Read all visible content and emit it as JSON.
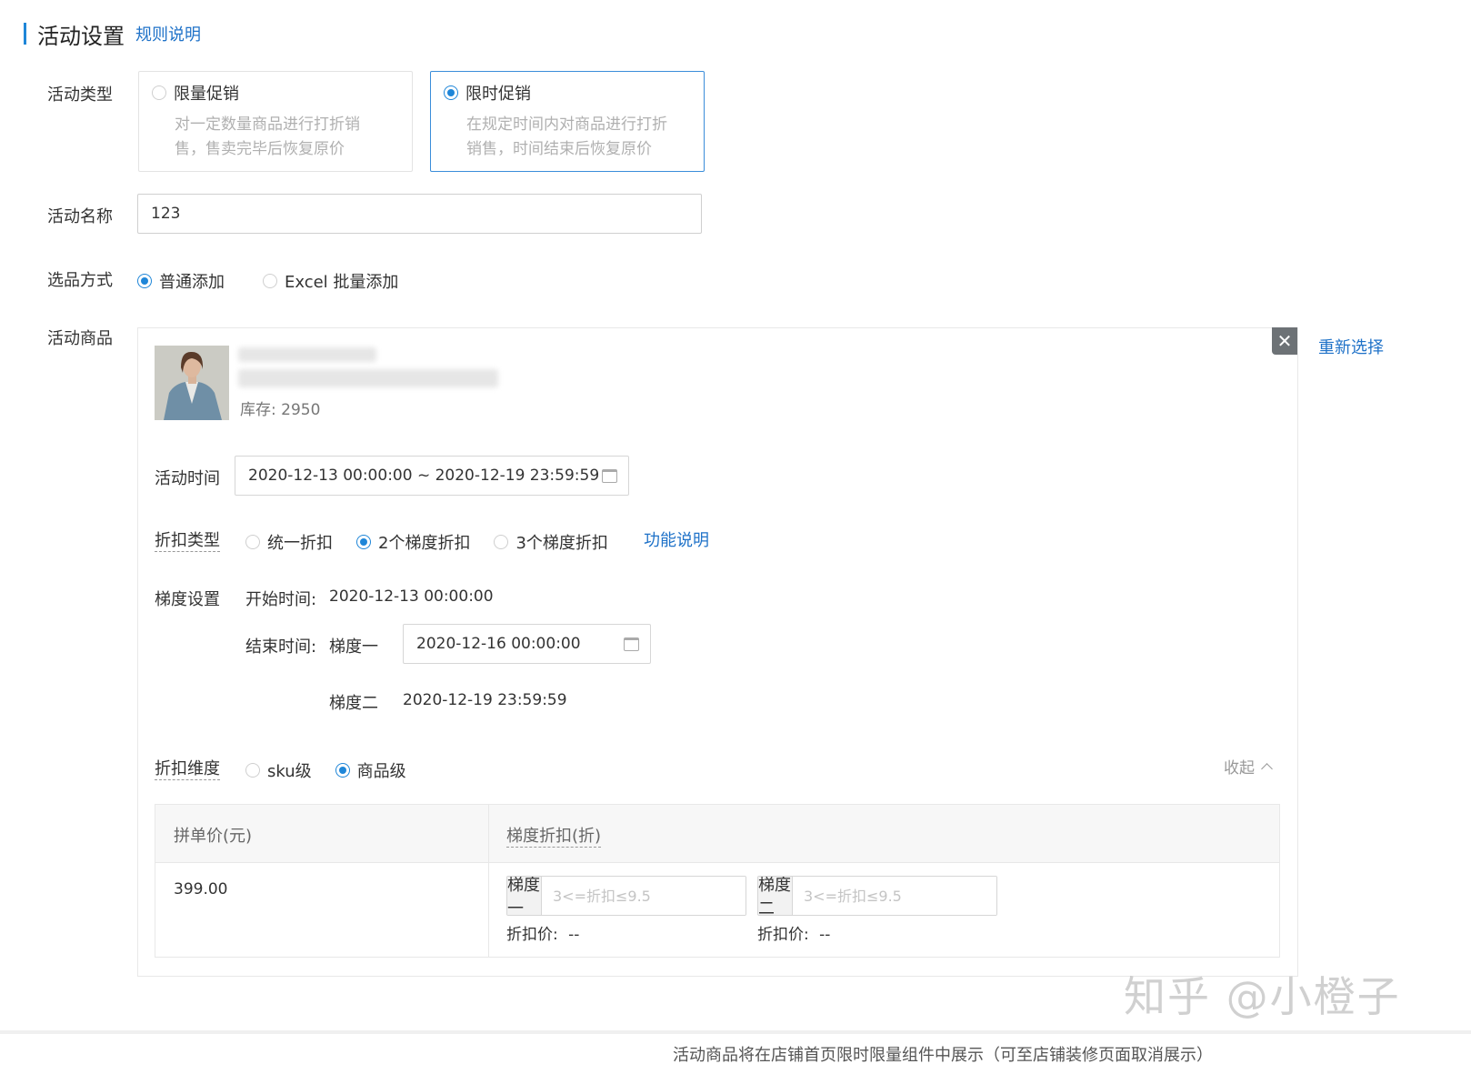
{
  "section": {
    "title": "活动设置",
    "rules_link": "规则说明"
  },
  "activity_type": {
    "label": "活动类型",
    "options": [
      {
        "title": "限量促销",
        "desc_line1": "对一定数量商品进行打折销",
        "desc_line2": "售，售卖完毕后恢复原价",
        "selected": false
      },
      {
        "title": "限时促销",
        "desc_line1": "在规定时间内对商品进行打折",
        "desc_line2": "销售，时间结束后恢复原价",
        "selected": true
      }
    ]
  },
  "activity_name": {
    "label": "活动名称",
    "value": "123"
  },
  "selection_method": {
    "label": "选品方式",
    "options": [
      "普通添加",
      "Excel 批量添加"
    ],
    "selected": "普通添加"
  },
  "activity_goods": {
    "label": "活动商品",
    "reselect": "重新选择",
    "close_icon": "close-icon",
    "stock": "库存: 2950",
    "time": {
      "label": "活动时间",
      "value": "2020-12-13 00:00:00 ~ 2020-12-19 23:59:59"
    },
    "discount_type": {
      "label": "折扣类型",
      "options": [
        "统一折扣",
        "2个梯度折扣",
        "3个梯度折扣"
      ],
      "selected": "2个梯度折扣",
      "help_link": "功能说明"
    },
    "tier_settings": {
      "label": "梯度设置",
      "start_label": "开始时间:",
      "start_value": "2020-12-13 00:00:00",
      "end_label": "结束时间:",
      "tier1_label": "梯度一",
      "tier1_value": "2020-12-16 00:00:00",
      "tier2_label": "梯度二",
      "tier2_value": "2020-12-19 23:59:59"
    },
    "discount_dimension": {
      "label": "折扣维度",
      "options": [
        "sku级",
        "商品级"
      ],
      "selected": "商品级",
      "collapse": "收起"
    },
    "table": {
      "headers": [
        "拼单价(元)",
        "梯度折扣(折)"
      ],
      "price": "399.00",
      "tiers": [
        {
          "label": "梯度一",
          "placeholder": "3<=折扣≤9.5",
          "price_label": "折扣价:",
          "price_value": "--"
        },
        {
          "label": "梯度二",
          "placeholder": "3<=折扣≤9.5",
          "price_label": "折扣价:",
          "price_value": "--"
        }
      ]
    }
  },
  "watermark": "知乎 @小橙子",
  "footer_text": "活动商品将在店铺首页限时限量组件中展示（可至店铺装修页面取消展示）",
  "colors": {
    "accent": "#1f86d8",
    "link": "#1f72c8",
    "border": "#e3e3e3"
  }
}
